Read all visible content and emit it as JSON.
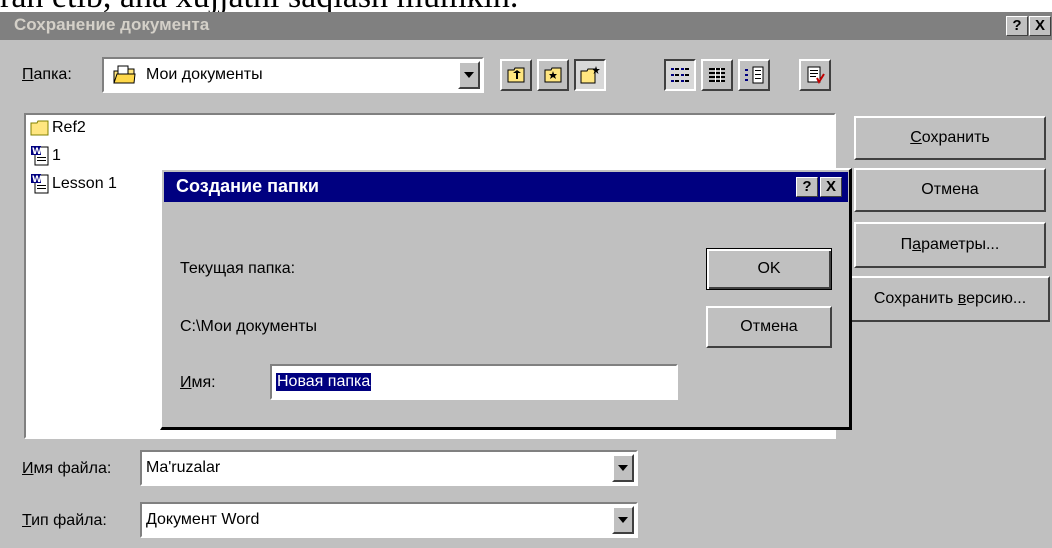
{
  "doc_text": "ran etib, ana xujjatni saqlash mumkin.",
  "save_dialog": {
    "title": "Сохранение документа",
    "help_btn": "?",
    "close_btn": "X",
    "folder_label": "Папка:",
    "folder_value": "Мои документы",
    "files": [
      {
        "name": "Ref2",
        "icon": "folder-icon"
      },
      {
        "name": "1",
        "icon": "word-document-icon"
      },
      {
        "name": "Lesson 1",
        "icon": "word-document-icon"
      }
    ],
    "buttons": {
      "save": "Сохранить",
      "cancel": "Отмена",
      "options": "Параметры...",
      "save_version": "Сохранить версию..."
    },
    "filename_label": "Имя файла:",
    "filename_value": "Ma'ruzalar",
    "filetype_label": "Тип файла:",
    "filetype_value": "Документ Word"
  },
  "new_folder_dialog": {
    "title": "Создание папки",
    "help_btn": "?",
    "close_btn": "X",
    "current_folder_label": "Текущая папка:",
    "current_folder_path": "C:\\Мои документы",
    "name_label": "Имя:",
    "name_value": "Новая папка",
    "ok": "OK",
    "cancel": "Отмена"
  },
  "colors": {
    "titlebar_inactive": "#808080",
    "titlebar_active": "#000080",
    "selection": "#000080",
    "face": "#c0c0c0"
  }
}
